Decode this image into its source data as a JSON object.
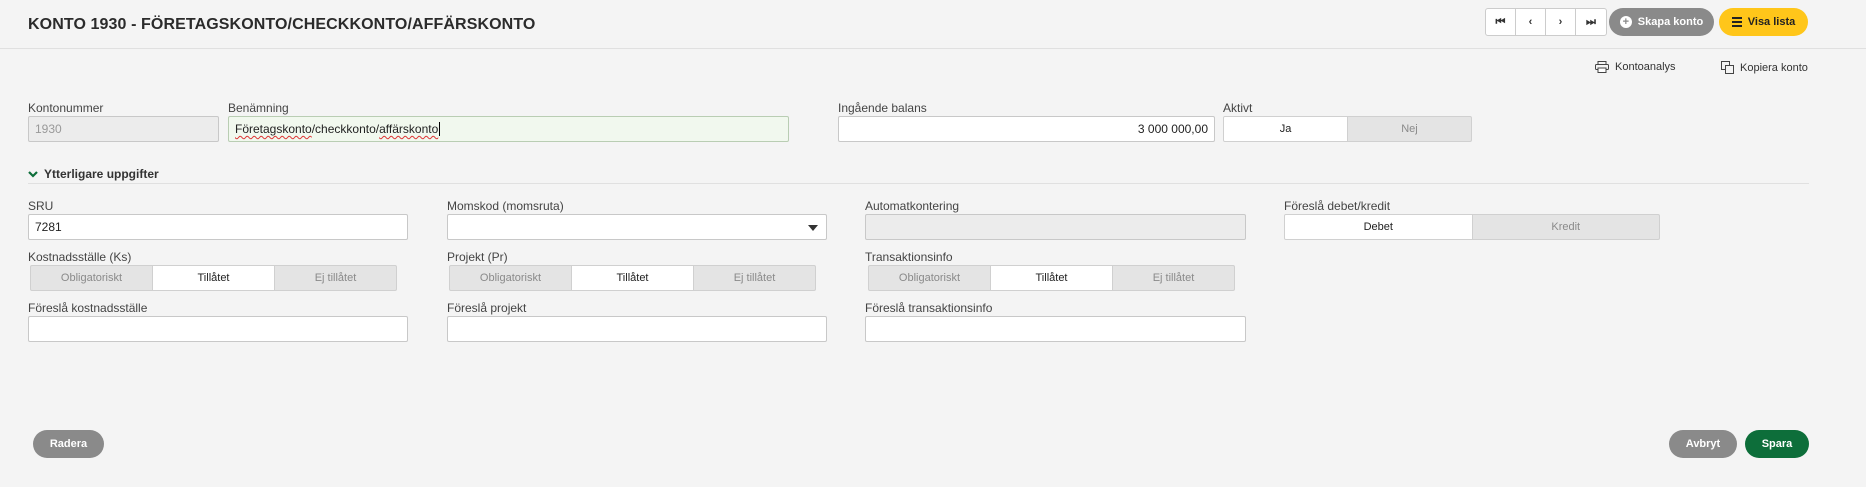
{
  "header": {
    "title": "KONTO 1930 - FÖRETAGSKONTO/CHECKKONTO/AFFÄRSKONTO",
    "nav": [
      "⏮",
      "‹",
      "›",
      "⏭"
    ],
    "create_label": "Skapa konto",
    "list_label": "Visa lista"
  },
  "tools": {
    "analysis_label": "Kontoanalys",
    "copy_label": "Kopiera konto"
  },
  "fields": {
    "account_number_label": "Kontonummer",
    "account_number_value": "1930",
    "name_label": "Benämning",
    "name_value_part1": "Företagskonto",
    "name_value_part2": "/checkkonto/",
    "name_value_part3": "affärskonto",
    "opening_balance_label": "Ingående balans",
    "opening_balance_value": "3 000 000,00",
    "active_label": "Aktivt",
    "active_options": [
      "Ja",
      "Nej"
    ],
    "active_selected": "Ja"
  },
  "section": {
    "title": "Ytterligare uppgifter",
    "sru_label": "SRU",
    "sru_value": "7281",
    "vat_label": "Momskod (momsruta)",
    "vat_value": "",
    "auto_label": "Automatkontering",
    "auto_value": "",
    "debit_credit_label": "Föreslå debet/kredit",
    "debit_credit_options": [
      "Debet",
      "Kredit"
    ],
    "cost_center_label": "Kostnadsställe (Ks)",
    "project_label": "Projekt (Pr)",
    "transaction_label": "Transaktionsinfo",
    "policy_options": [
      "Obligatoriskt",
      "Tillåtet",
      "Ej tillåtet"
    ],
    "policy_selected": "Tillåtet",
    "suggest_cost_center_label": "Föreslå kostnadsställe",
    "suggest_project_label": "Föreslå projekt",
    "suggest_transaction_label": "Föreslå transaktionsinfo"
  },
  "footer": {
    "delete_label": "Radera",
    "cancel_label": "Avbryt",
    "save_label": "Spara"
  },
  "colors": {
    "accent_yellow": "#ffc61a",
    "save_green": "#0d6e3a",
    "gray_button": "#8a8a8a"
  }
}
